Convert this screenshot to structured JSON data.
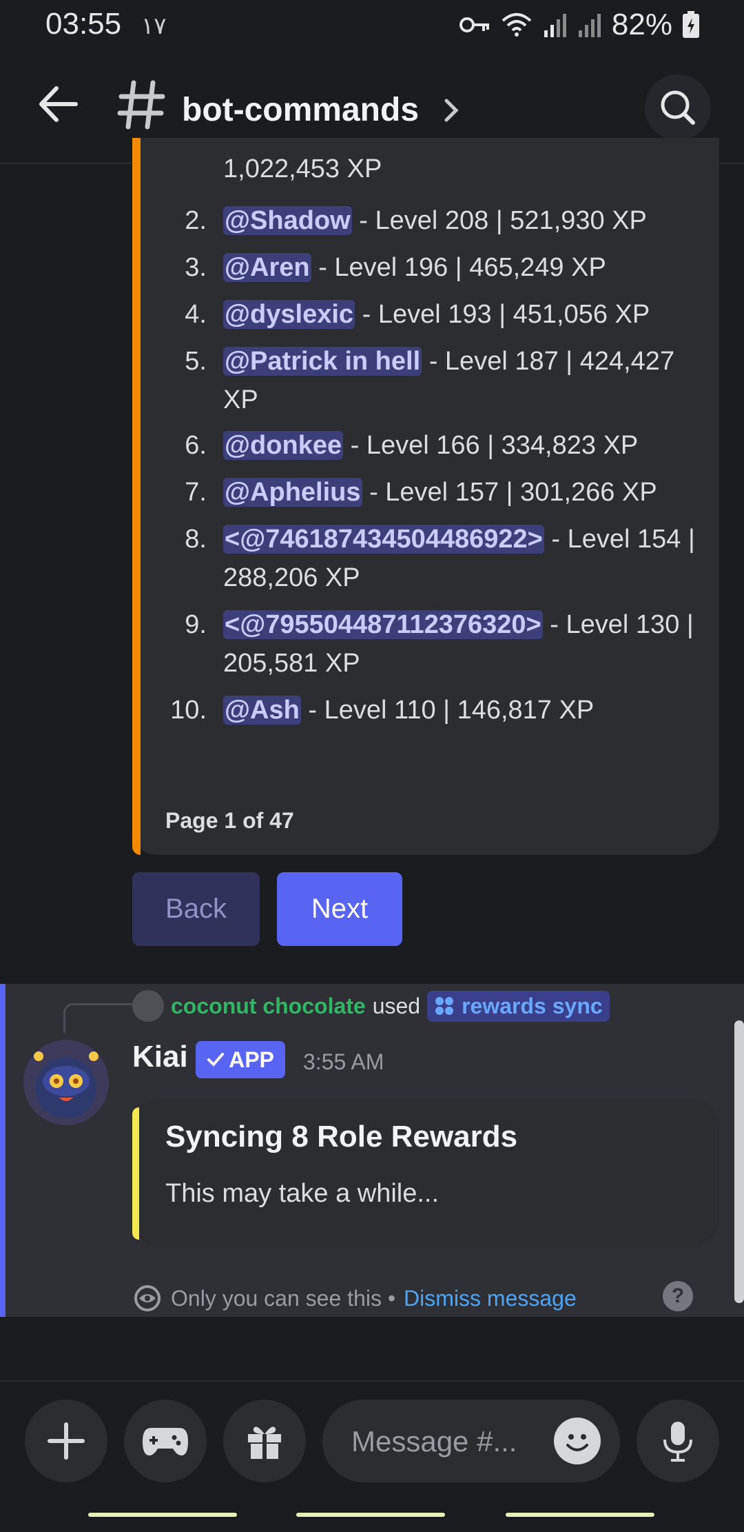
{
  "status_bar": {
    "time": "03:55",
    "extra": "١٧",
    "battery": "82%"
  },
  "header": {
    "channel_name": "bot-commands"
  },
  "leaderboard": {
    "cut_off_text": "1,022,453 XP",
    "rows": [
      {
        "num": "2.",
        "mention": "@Shadow",
        "rest": " - Level 208 | 521,930 XP"
      },
      {
        "num": "3.",
        "mention": "@Aren",
        "rest": " - Level 196 | 465,249 XP"
      },
      {
        "num": "4.",
        "mention": "@dyslexic",
        "rest": " - Level 193 | 451,056 XP"
      },
      {
        "num": "5.",
        "mention": "@Patrick in hell",
        "rest": " - Level 187 | 424,427 XP"
      },
      {
        "num": "6.",
        "mention": "@donkee",
        "rest": " - Level 166 | 334,823 XP"
      },
      {
        "num": "7.",
        "mention": "@Aphelius",
        "rest": " - Level 157 | 301,266 XP"
      },
      {
        "num": "8.",
        "mention": "<@746187434504486922>",
        "rest": " - Level 154 | 288,206 XP"
      },
      {
        "num": "9.",
        "mention": "<@795504487112376320>",
        "rest": " - Level 130 | 205,581 XP"
      },
      {
        "num": "10.",
        "mention": "@Ash",
        "rest": " - Level 110 | 146,817 XP"
      }
    ],
    "footer": "Page 1 of 47"
  },
  "buttons": {
    "back_label": "Back",
    "next_label": "Next"
  },
  "ephemeral": {
    "command_user": "coconut chocolate",
    "used_word": "used",
    "command_name": "rewards sync",
    "bot_name": "Kiai",
    "app_badge": "APP",
    "timestamp": "3:55 AM",
    "embed_title": "Syncing 8 Role Rewards",
    "embed_desc": "This may take a while...",
    "note": "Only you can see this •",
    "dismiss": "Dismiss message",
    "help": "?",
    "accent_colors": {
      "ephemeral_bar": "#5865f2",
      "embed_bar": "#f4ea4f",
      "leaderboard_bar": "#f48a00"
    }
  },
  "input": {
    "placeholder": "Message #..."
  },
  "icons": [
    "back-arrow-icon",
    "hash-icon",
    "chevron-right-icon",
    "search-icon",
    "plus-icon",
    "gamepad-icon",
    "gift-icon",
    "emoji-icon",
    "microphone-icon",
    "eye-icon",
    "checkmark-icon",
    "slash-command-icon",
    "key-icon",
    "wifi-icon",
    "signal-icon",
    "battery-icon"
  ]
}
